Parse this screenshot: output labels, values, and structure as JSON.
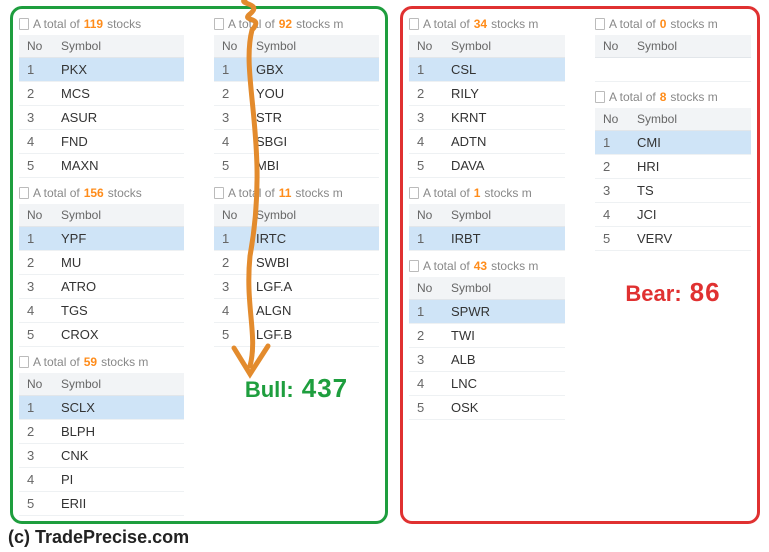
{
  "labels": {
    "col_no": "No",
    "col_symbol": "Symbol",
    "total_prefix": "A total of",
    "total_suffix_s": "stocks",
    "total_suffix_m": "stocks m",
    "bull_label": "Bull:",
    "bear_label": "Bear:",
    "watermark": "(c) TradePrecise.com"
  },
  "bull": {
    "total": 437,
    "left": [
      {
        "count": 119,
        "suffix": "stocks",
        "rows": [
          [
            1,
            "PKX"
          ],
          [
            2,
            "MCS"
          ],
          [
            3,
            "ASUR"
          ],
          [
            4,
            "FND"
          ],
          [
            5,
            "MAXN"
          ]
        ]
      },
      {
        "count": 156,
        "suffix": "stocks",
        "rows": [
          [
            1,
            "YPF"
          ],
          [
            2,
            "MU"
          ],
          [
            3,
            "ATRO"
          ],
          [
            4,
            "TGS"
          ],
          [
            5,
            "CROX"
          ]
        ]
      },
      {
        "count": 59,
        "suffix": "stocks m",
        "rows": [
          [
            1,
            "SCLX"
          ],
          [
            2,
            "BLPH"
          ],
          [
            3,
            "CNK"
          ],
          [
            4,
            "PI"
          ],
          [
            5,
            "ERII"
          ]
        ]
      }
    ],
    "right": [
      {
        "count": 92,
        "suffix": "stocks m",
        "rows": [
          [
            1,
            "GBX"
          ],
          [
            2,
            "YOU"
          ],
          [
            3,
            "STR"
          ],
          [
            4,
            "SBGI"
          ],
          [
            5,
            "MBI"
          ]
        ]
      },
      {
        "count": 11,
        "suffix": "stocks m",
        "rows": [
          [
            1,
            "IRTC"
          ],
          [
            2,
            "SWBI"
          ],
          [
            3,
            "LGF.A"
          ],
          [
            4,
            "ALGN"
          ],
          [
            5,
            "LGF.B"
          ]
        ]
      }
    ]
  },
  "bear": {
    "total": 86,
    "left": [
      {
        "count": 34,
        "suffix": "stocks m",
        "rows": [
          [
            1,
            "CSL"
          ],
          [
            2,
            "RILY"
          ],
          [
            3,
            "KRNT"
          ],
          [
            4,
            "ADTN"
          ],
          [
            5,
            "DAVA"
          ]
        ]
      },
      {
        "count": 1,
        "suffix": "stocks m",
        "rows": [
          [
            1,
            "IRBT"
          ]
        ]
      },
      {
        "count": 43,
        "suffix": "stocks m",
        "rows": [
          [
            1,
            "SPWR"
          ],
          [
            2,
            "TWI"
          ],
          [
            3,
            "ALB"
          ],
          [
            4,
            "LNC"
          ],
          [
            5,
            "OSK"
          ]
        ]
      }
    ],
    "right": [
      {
        "count": 0,
        "suffix": "stocks m",
        "rows": []
      },
      {
        "count": 8,
        "suffix": "stocks m",
        "rows": [
          [
            1,
            "CMI"
          ],
          [
            2,
            "HRI"
          ],
          [
            3,
            "TS"
          ],
          [
            4,
            "JCI"
          ],
          [
            5,
            "VERV"
          ]
        ]
      }
    ]
  },
  "colors": {
    "bull": "#1e9e3e",
    "bear": "#e03131",
    "count": "#ff8c1a"
  }
}
